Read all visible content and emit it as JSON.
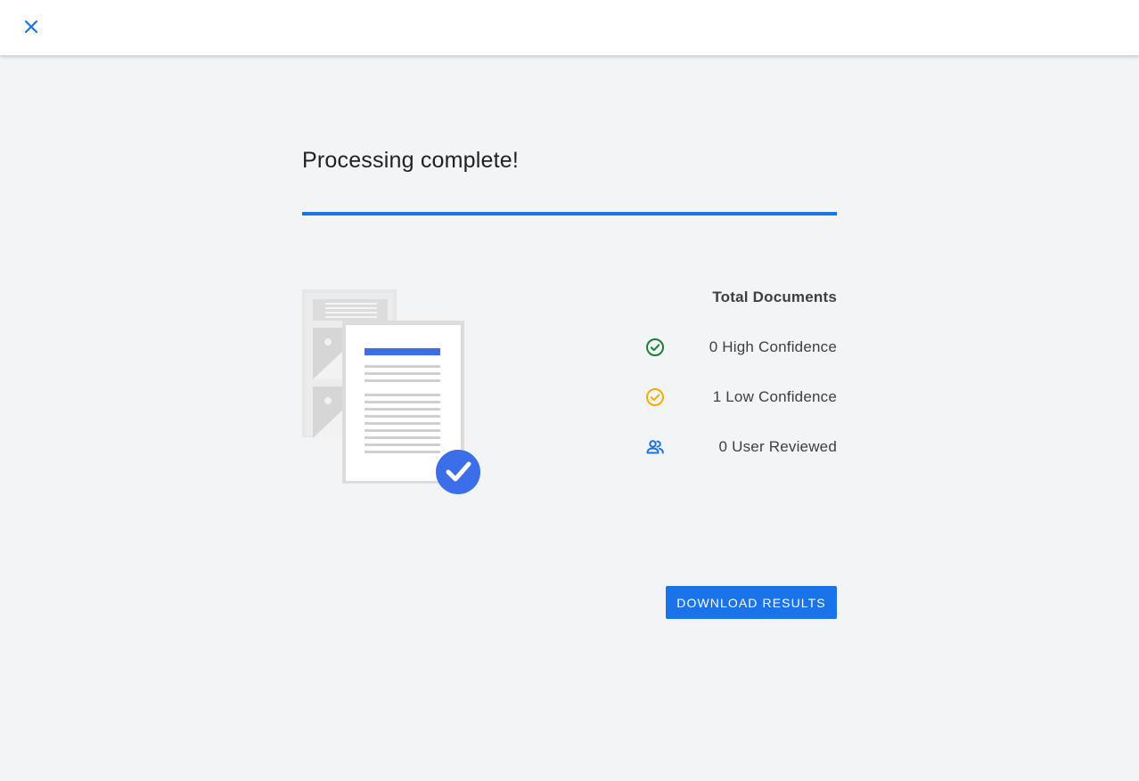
{
  "header": {
    "close_icon": "close-icon"
  },
  "main": {
    "title": "Processing complete!",
    "progress": 1.0,
    "stats": {
      "heading": "Total Documents",
      "items": [
        {
          "label": "0 High Confidence",
          "icon": "check-circle-icon",
          "color": "#188038"
        },
        {
          "label": "1 Low Confidence",
          "icon": "check-circle-icon",
          "color": "#f9ab00"
        },
        {
          "label": "0 User Reviewed",
          "icon": "people-icon",
          "color": "#1a73e8"
        }
      ]
    },
    "download_label": "DOWNLOAD RESULTS"
  },
  "colors": {
    "accent": "#1a73e8",
    "background": "#f3f4f6"
  }
}
